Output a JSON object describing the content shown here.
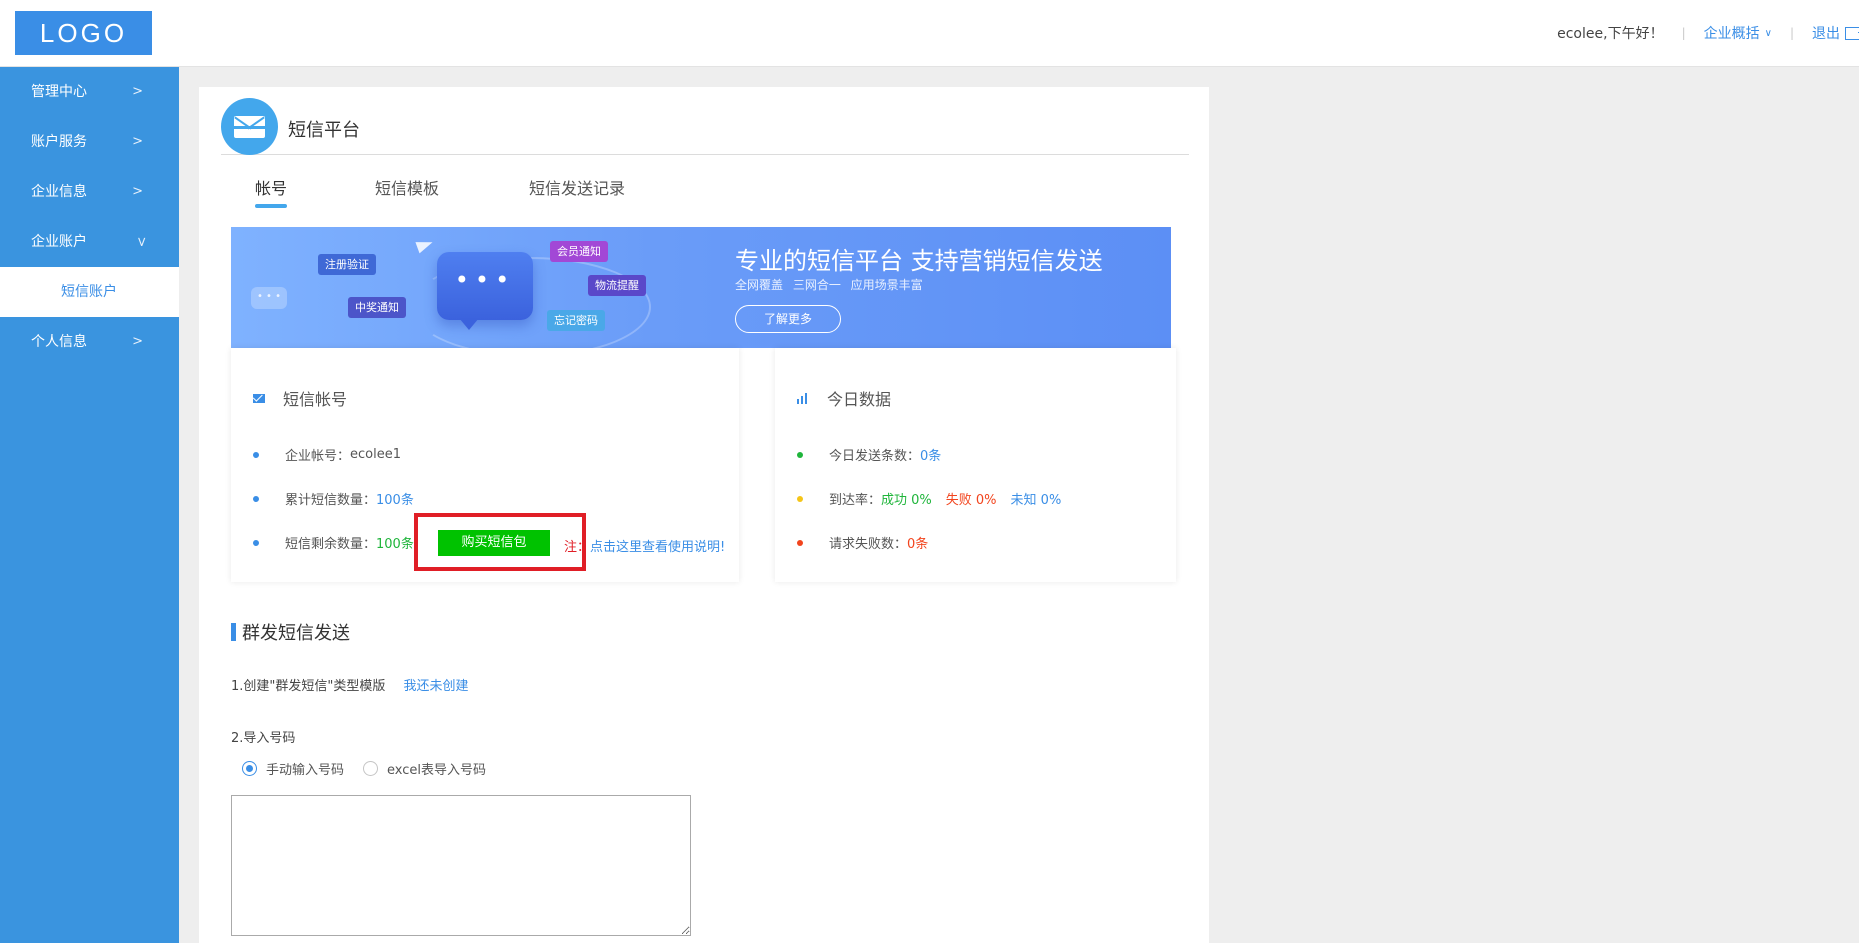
{
  "header": {
    "logo": "LOGO",
    "greeting": "ecolee,下午好！",
    "company_menu": "企业概括",
    "logout": "退出"
  },
  "sidebar": {
    "items": [
      {
        "label": "管理中心"
      },
      {
        "label": "账户服务"
      },
      {
        "label": "企业信息"
      },
      {
        "label": "企业账户"
      },
      {
        "label": "个人信息"
      }
    ],
    "sub_item": "短信账户"
  },
  "page": {
    "title": "短信平台",
    "tabs": [
      {
        "label": "帐号"
      },
      {
        "label": "短信模板"
      },
      {
        "label": "短信发送记录"
      }
    ]
  },
  "banner": {
    "tags": [
      "注册验证",
      "中奖通知",
      "会员通知",
      "物流提醒",
      "忘记密码"
    ],
    "title": "专业的短信平台  支持营销短信发送",
    "subtitle": "全网覆盖  三网合一  应用场景丰富",
    "button": "了解更多"
  },
  "account_panel": {
    "title": "短信帐号",
    "rows": [
      {
        "label": "企业帐号：",
        "value": "ecolee1"
      },
      {
        "label": "累计短信数量：",
        "value": "100条"
      },
      {
        "label": "短信剩余数量：",
        "value": "100条"
      }
    ],
    "buy_button": "购买短信包",
    "note_prefix": "注：",
    "note_link": "点击这里查看使用说明!"
  },
  "today_panel": {
    "title": "今日数据",
    "sent_label": "今日发送条数：",
    "sent_value": "0条",
    "rate_label": "到达率：",
    "rate_success": "成功 0%",
    "rate_fail": "失败 0%",
    "rate_unknown": "未知 0%",
    "fail_label": "请求失败数：",
    "fail_value": "0条"
  },
  "bulk": {
    "title": "群发短信发送",
    "step1": "1.创建\"群发短信\"类型模版",
    "step1_link": "我还未创建",
    "step2": "2.导入号码",
    "radio_manual": "手动输入号码",
    "radio_excel": "excel表导入号码",
    "textarea_value": ""
  },
  "colors": {
    "sidebar": "#3a94df",
    "accent": "#3a8ee6",
    "buy_button": "#00c200",
    "highlight": "#e01e26",
    "success": "#1fb53b",
    "fail": "#f2441d"
  }
}
